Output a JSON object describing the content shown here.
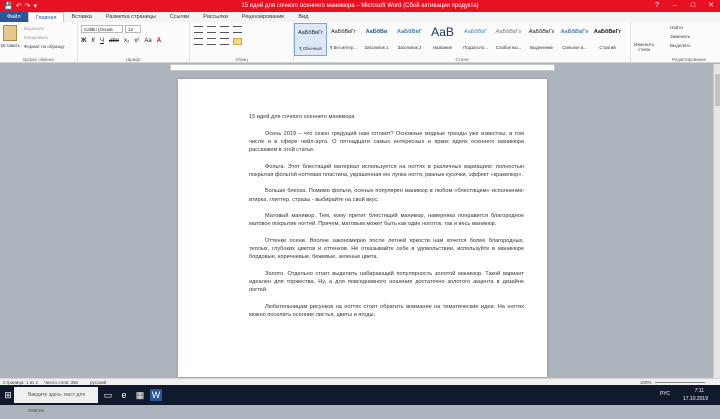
{
  "window": {
    "title": "15 идей для сочного осеннего маникюра – Microsoft Word (Сбой активации продукта)"
  },
  "qat": {
    "save": "💾",
    "undo": "↶",
    "redo": "↷",
    "customize": "▾"
  },
  "controls": {
    "help": "?",
    "min": "–",
    "max": "□",
    "close": "✕"
  },
  "tabs": [
    "Файл",
    "Главная",
    "Вставка",
    "Разметка страницы",
    "Ссылки",
    "Рассылки",
    "Рецензирование",
    "Вид"
  ],
  "clipboard": {
    "paste": "Вставить",
    "cut": "Вырезать",
    "copy": "Копировать",
    "format": "Формат по образцу",
    "label": "Буфер обмена"
  },
  "font": {
    "name": "Calibri (Основ",
    "size": "12",
    "label": "Шрифт",
    "buttons": [
      "Ж",
      "К",
      "Ч",
      "abe",
      "x₂",
      "x²",
      "Аа",
      "A"
    ]
  },
  "paragraph": {
    "label": "Абзац"
  },
  "styles": {
    "label": "Стили",
    "items": [
      {
        "preview": "АаБбВвГг",
        "name": "¶ Обычный"
      },
      {
        "preview": "АаБбВвГг",
        "name": "¶ Без интер..."
      },
      {
        "preview": "АаБбВв",
        "name": "Заголовок 1"
      },
      {
        "preview": "АаБбВвГ",
        "name": "Заголовок 2"
      },
      {
        "preview": "АаВ",
        "name": "Название"
      },
      {
        "preview": "АаБбВвГ",
        "name": "Подзаголо..."
      },
      {
        "preview": "АаБбВвГг",
        "name": "Слабое вы..."
      },
      {
        "preview": "АаБбВвГг",
        "name": "Выделение"
      },
      {
        "preview": "АаБбВвГг",
        "name": "Сильное в..."
      },
      {
        "preview": "АаБбВвГг",
        "name": "Строгий"
      }
    ],
    "change": "Изменить стили"
  },
  "editing": {
    "find": "Найти",
    "replace": "Заменить",
    "select": "Выделить",
    "label": "Редактирование"
  },
  "document": {
    "heading": "15 идей для сочного осеннего маникюра",
    "paragraphs": [
      "Осень 2019 – что сезон грядущий нам готовит? Основные модные тренды уже известны, в том числе и в сфере нейл-арта. О пятнадцати самых интересных и ярких идеях осеннего маникюра расскажем в этой статье.",
      "Фольга. Этот блестящий материал используется на ногтях в различных вариациях: полностью покрытая фольгой ногтевая пластина, украшенная ею лунка ногтя, рваные кусочки, эффект «кракелюр».",
      "Больше блеска. Помимо фольги, осенью популярен маникюр в любом «блестящем» исполнении: втирка, глиттер, стразы - выбирайте на свой вкус.",
      "Матовый маникюр. Тем, кому претит блестящий маникюр, наверняка понравится благородное матовое покрытие ногтей. Причем, матовым может быть как один ноготок, так и весь маникюр.",
      "Оттенки осени. Вполне закономерно после летней яркости нам хочется более благородных, теплых, глубоких цветов и оттенков. Не отказывайте себе в удовольствии, используйте в маникюре бордовые, коричневые, бежевые, зеленые цвета.",
      "Золото. Отдельно стоит выделить набирающий популярность золотой маникюр. Такой вариант идеален для торжества. Ну, а для повседневного ношения достаточно золотого акцента в дизайне ногтей.",
      "Любительницам рисунков на ногтях стоит обратить внимание на тематические идеи. На ногтях можно поселить осенние листья, цветы и ягоды."
    ]
  },
  "status": {
    "page": "Страница: 1 из 2",
    "words": "Число слов: 356",
    "lang": "русский",
    "zoom": "100%"
  },
  "taskbar": {
    "search": "Введите здесь текст для поиска",
    "lang": "РУС",
    "time": "7:11",
    "date": "17.10.2019"
  }
}
